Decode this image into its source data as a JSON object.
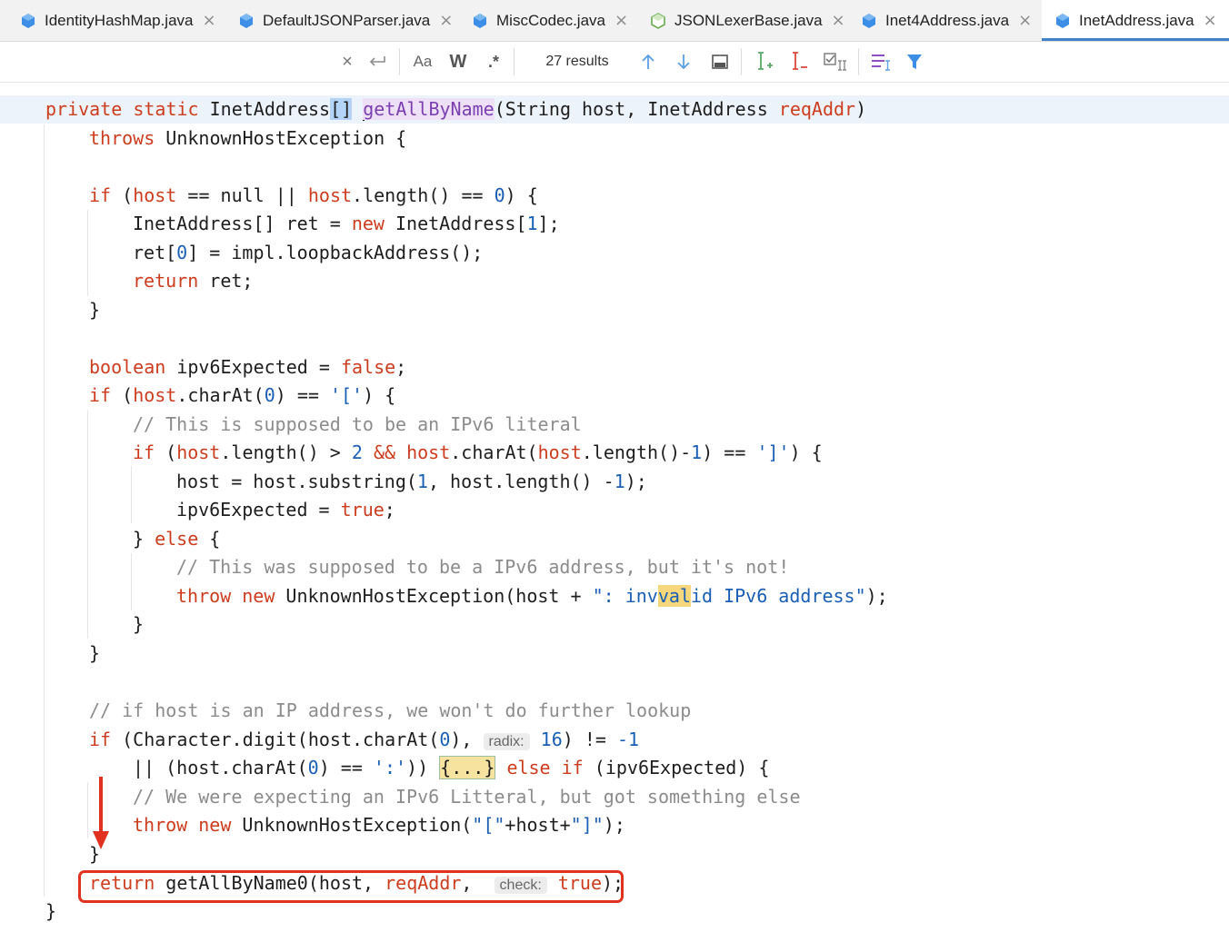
{
  "tabs": [
    {
      "label": "IdentityHashMap.java",
      "icon": "java-class-icon"
    },
    {
      "label": "DefaultJSONParser.java",
      "icon": "java-class-icon"
    },
    {
      "label": "MiscCodec.java",
      "icon": "java-class-icon"
    },
    {
      "label": "JSONLexerBase.java",
      "icon": "java-abstract-class-icon"
    },
    {
      "label": "Inet4Address.java",
      "icon": "java-class-icon"
    },
    {
      "label": "InetAddress.java",
      "icon": "java-class-icon",
      "active": true
    }
  ],
  "find_bar": {
    "results": "27 results",
    "match_case_label": "Aa",
    "words_label": "W",
    "regex_label": ".*"
  },
  "code": {
    "l1": {
      "kw": "private static",
      "type": " InetAddress",
      "br": "[]",
      "sp": " ",
      "method": "getAllByName",
      "a": "(String host, InetAddress ",
      "param": "reqAddr",
      "b": ")"
    },
    "l2": {
      "kw": "throws",
      "rest": " UnknownHostException {"
    },
    "l4": {
      "kw": "if",
      "a": " (",
      "p1": "host",
      "b": " == null || ",
      "p2": "host",
      "c": ".length() == ",
      "num": "0",
      "d": ") {"
    },
    "l5": {
      "a": "InetAddress[] ret = ",
      "kw": "new",
      "b": " InetAddress[",
      "num": "1",
      "c": "];"
    },
    "l6": {
      "a": "ret[",
      "num": "0",
      "b": "] = impl.loopbackAddress();"
    },
    "l7": {
      "kw": "return",
      "rest": " ret;"
    },
    "l8": {
      "rest": "}"
    },
    "l10": {
      "kw": "boolean",
      "a": " ipv6Expected = ",
      "kw2": "false",
      "b": ";"
    },
    "l11": {
      "kw": "if",
      "a": " (",
      "p1": "host",
      "b": ".charAt(",
      "num": "0",
      "c": ") == ",
      "str": "'['",
      "d": ") {"
    },
    "l12": {
      "comment": "// This is supposed to be an IPv6 literal"
    },
    "l13": {
      "kw": "if",
      "a": " (",
      "p1": "host",
      "b": ".length() > ",
      "num": "2",
      "c": " && ",
      "p2": "host",
      "d": ".charAt(",
      "p3": "host",
      "e": ".length()-",
      "num2": "1",
      "f": ") == ",
      "str": "']'",
      "g": ") {"
    },
    "l14": {
      "a": "host = host.substring(",
      "num": "1",
      "b": ", host.length() -",
      "num2": "1",
      "c": ");"
    },
    "l15": {
      "a": "ipv6Expected = ",
      "kw": "true",
      "b": ";"
    },
    "l16": {
      "a": "} ",
      "kw": "else",
      "b": " {"
    },
    "l17": {
      "comment": "// This was supposed to be a IPv6 address, but it's not!"
    },
    "l18": {
      "kw": "throw new",
      "a": " UnknownHostException(host + ",
      "s1": "\": inv",
      "hit": "val",
      "s2": "id IPv6 address\"",
      "b": ");"
    },
    "l19": {
      "rest": "}"
    },
    "l20": {
      "rest": "}"
    },
    "l22": {
      "comment": "// if host is an IP address, we won't do further lookup"
    },
    "l23": {
      "kw": "if",
      "a": " (Character.digit(host.charAt(",
      "num": "0",
      "b": "), ",
      "hint": "radix:",
      "num2": "16",
      "c": ") != ",
      "num3": "-1"
    },
    "l24": {
      "a": "|| (host.charAt(",
      "num": "0",
      "b": ") == ",
      "str": "':'",
      "c": ")) ",
      "fold": "{...}",
      "d": " ",
      "kw": "else if",
      "e": " (ipv6Expected) {"
    },
    "l25": {
      "comment": "// We were expecting an IPv6 Litteral, but got something else"
    },
    "l26": {
      "kw": "throw new",
      "a": " UnknownHostException(",
      "s1": "\"[\"",
      "b": "+host+",
      "s2": "\"]\"",
      "c": ");"
    },
    "l27": {
      "rest": "}"
    },
    "l28": {
      "kw": "return",
      "a": " getAllByName0(host, ",
      "param": "reqAddr",
      "b": ",  ",
      "hint": "check:",
      "kw2": "true",
      "c": ");"
    },
    "l29": {
      "rest": "}"
    }
  },
  "colors": {
    "keyword": "#cc3d1e",
    "number": "#1a5fb4",
    "comment": "#8c8c8c",
    "annotation": "#e0321e",
    "tab_active_underline": "#4083c9"
  }
}
